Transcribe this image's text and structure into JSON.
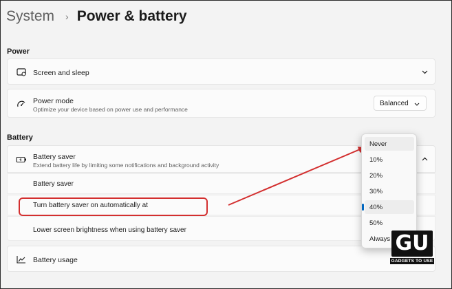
{
  "breadcrumb": {
    "parent": "System",
    "separator": "›",
    "current": "Power & battery"
  },
  "power": {
    "section_label": "Power",
    "screen_sleep": {
      "title": "Screen and sleep",
      "icon": "screen-icon"
    },
    "power_mode": {
      "title": "Power mode",
      "subtitle": "Optimize your device based on power use and performance",
      "value": "Balanced",
      "icon": "power-mode-icon"
    }
  },
  "battery": {
    "section_label": "Battery",
    "saver": {
      "title": "Battery saver",
      "subtitle": "Extend battery life by limiting some notifications and background activity",
      "icon": "battery-saver-icon"
    },
    "rows": [
      {
        "label": "Battery saver"
      },
      {
        "label": "Turn battery saver on automatically at"
      },
      {
        "label": "Lower screen brightness when using battery saver"
      }
    ],
    "usage": {
      "title": "Battery usage",
      "icon": "chart-icon"
    }
  },
  "flyout": {
    "options": [
      "Never",
      "10%",
      "20%",
      "30%",
      "40%",
      "50%",
      "Always"
    ],
    "selected": "40%",
    "hovered": "Never"
  },
  "annotation": {
    "arrow_color": "#d32f2f",
    "highlight_color": "#d32f2f"
  },
  "watermark": {
    "letters": "GU",
    "text": "GADGETS TO USE"
  }
}
